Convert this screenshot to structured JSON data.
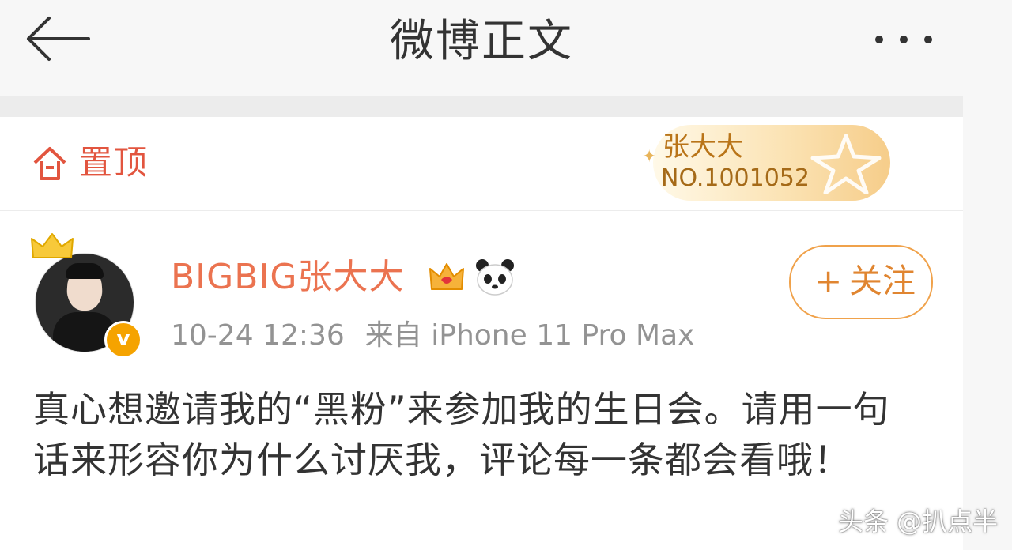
{
  "nav": {
    "title": "微博正文",
    "back_icon": "arrow-left-icon",
    "more_icon": "more-dots-icon"
  },
  "pinned": {
    "label": "置顶",
    "icon": "pin-top-icon",
    "color": "#e2553f"
  },
  "fan_badge": {
    "name": "张大大",
    "number": "NO.1001052"
  },
  "post": {
    "author": "BIGBIG张大大",
    "timestamp": "10-24 12:36",
    "source": "来自 iPhone 11 Pro Max",
    "follow_plus": "+",
    "follow_label": "关注",
    "verified_mark": "v",
    "text": "真心想邀请我的“黑粉”来参加我的生日会。请用一句话来形容你为什么讨厌我，评论每一条都会看哦！",
    "author_color": "#eb7350"
  },
  "watermark": "头条 @扒点半"
}
